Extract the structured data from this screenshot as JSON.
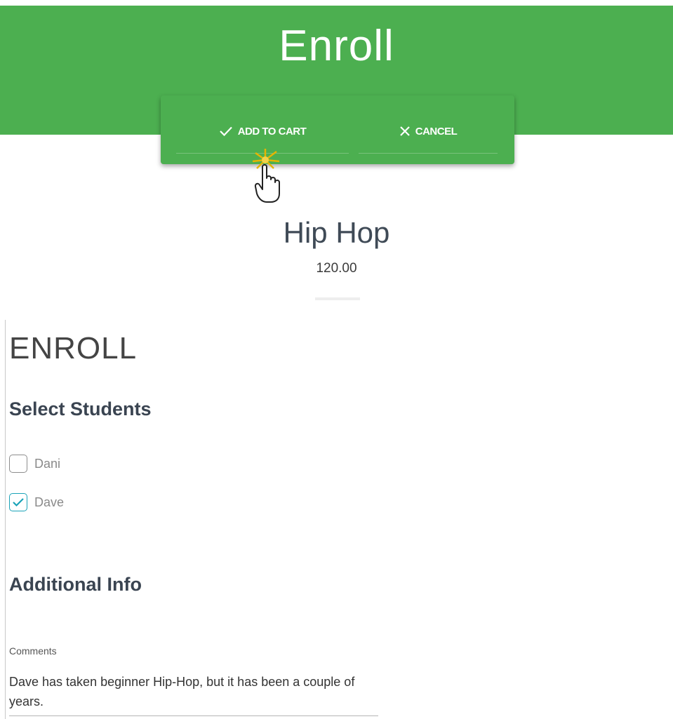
{
  "header": {
    "title": "Enroll"
  },
  "toolbar": {
    "add_to_cart_label": "ADD TO CART",
    "cancel_label": "CANCEL"
  },
  "icons": {
    "add": "check-icon",
    "cancel": "close-icon",
    "cursor": "hand-pointer-icon"
  },
  "course": {
    "title": "Hip Hop",
    "price": "120.00"
  },
  "form": {
    "section_title": "ENROLL",
    "students_heading": "Select Students",
    "students": [
      {
        "name": "Dani",
        "checked": false
      },
      {
        "name": "Dave",
        "checked": true
      }
    ],
    "additional_heading": "Additional Info",
    "comments_label": "Comments",
    "comments_value": "Dave has taken beginner Hip-Hop, but it has been a couple of years."
  },
  "colors": {
    "header_green": "#4caf50",
    "checkbox_accent": "#1aa3b8"
  }
}
